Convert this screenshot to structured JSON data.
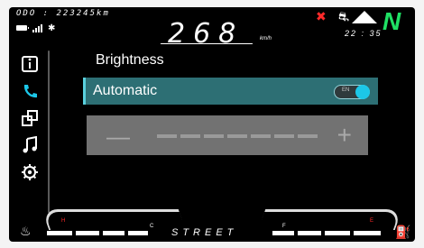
{
  "status": {
    "odometer": "ODO : 223245km",
    "speed": "268",
    "speed_unit": "km/h",
    "clock": "22 : 35",
    "gear": "N",
    "icons": [
      "battery-icon",
      "signal-icon",
      "bluetooth-icon",
      "warning-icon",
      "motorbike-icon",
      "up-arrow-icon"
    ]
  },
  "sidebar": {
    "items": [
      {
        "icon": "info-icon"
      },
      {
        "icon": "phone-icon"
      },
      {
        "icon": "window-icon"
      },
      {
        "icon": "music-icon"
      },
      {
        "icon": "settings-icon"
      }
    ]
  },
  "settings": {
    "section_title": "Brightness",
    "automatic_label": "Automatic",
    "toggle_text": "EN",
    "toggle_state": "on",
    "slider": {
      "minus": "—",
      "plus": "+",
      "level": 0
    }
  },
  "bottom": {
    "mode": "STREET",
    "labels_left": {
      "h": "H",
      "c": "C"
    },
    "labels_right": {
      "f": "F",
      "e": "E"
    }
  },
  "colors": {
    "accent": "#1cc7e8",
    "gear": "#1fe064",
    "selected_row": "#2d6f74",
    "warning": "#ff2a2a"
  }
}
